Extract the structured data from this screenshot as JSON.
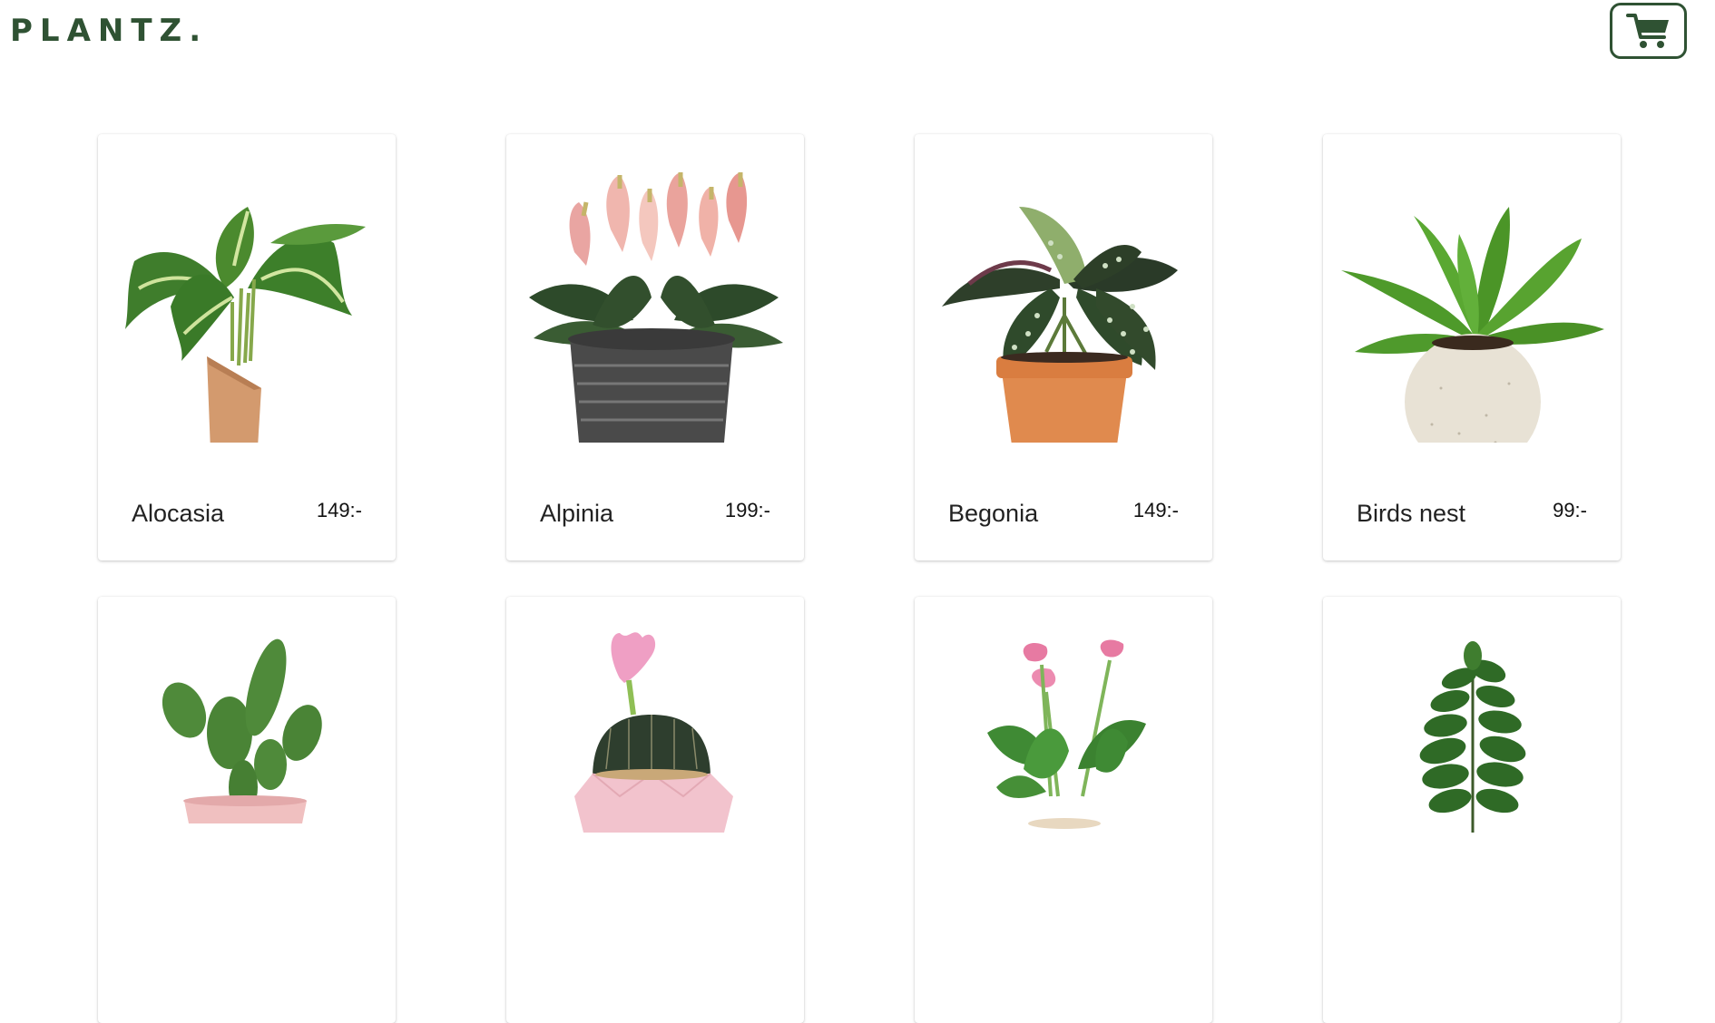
{
  "brand": {
    "logo_text": "PLANTZ."
  },
  "cart": {
    "icon": "shopping-cart-icon"
  },
  "colors": {
    "accent": "#2f5233",
    "background": "#ffffff"
  },
  "products": [
    {
      "name": "Alocasia",
      "price": "149:-",
      "image": "alocasia-plant-image"
    },
    {
      "name": "Alpinia",
      "price": "199:-",
      "image": "alpinia-plant-image"
    },
    {
      "name": "Begonia",
      "price": "149:-",
      "image": "begonia-plant-image"
    },
    {
      "name": "Birds nest",
      "price": "99:-",
      "image": "birds-nest-plant-image"
    },
    {
      "name": "",
      "price": "",
      "image": "cactus-plant-image"
    },
    {
      "name": "",
      "price": "",
      "image": "flowering-cactus-plant-image"
    },
    {
      "name": "",
      "price": "",
      "image": "calla-lily-plant-image"
    },
    {
      "name": "",
      "price": "",
      "image": "fiddle-leaf-fig-plant-image"
    }
  ]
}
